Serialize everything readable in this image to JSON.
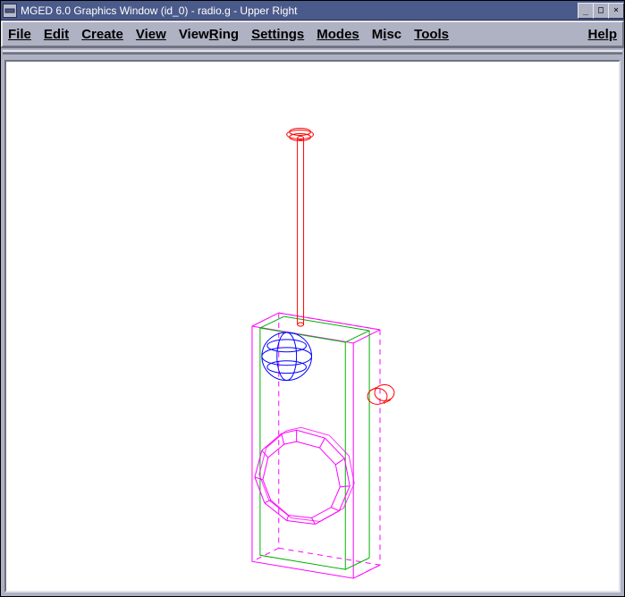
{
  "window": {
    "title": "MGED 6.0 Graphics Window (id_0) - radio.g - Upper Right"
  },
  "menu": {
    "file": "File",
    "edit": "Edit",
    "create": "Create",
    "view": "View",
    "viewring": "ViewRing",
    "settings": "Settings",
    "modes": "Modes",
    "misc": "Misc",
    "tools": "Tools",
    "help": "Help"
  },
  "colors": {
    "magenta": "#ff00ff",
    "red": "#ff0000",
    "green": "#00cc00",
    "blue": "#0000ff"
  },
  "model": {
    "description": "Wireframe CAD model of a walkie-talkie radio: outer magenta box (solid + dashed), inner green box, magenta torus speaker ring, blue sphere knob, tall red antenna cylinder with ellipse cap, small red side button."
  }
}
